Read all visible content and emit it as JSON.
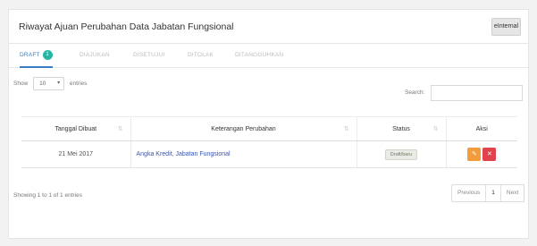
{
  "panel": {
    "title": "Riwayat Ajuan Perubahan Data Jabatan Fungsional",
    "internal_button": "eInternal"
  },
  "tabs": [
    {
      "label": "DRAFT",
      "count": "1",
      "active": true
    },
    {
      "label": "DIAJUKAN",
      "active": false
    },
    {
      "label": "DISETUJUI",
      "active": false
    },
    {
      "label": "DITOLAK",
      "active": false
    },
    {
      "label": "DITANGGUHKAN",
      "active": false
    }
  ],
  "length_control": {
    "show": "Show",
    "value": "10",
    "entries": "entries"
  },
  "search": {
    "label": "Search:",
    "placeholder": ""
  },
  "table": {
    "headers": [
      "Tanggal Dibuat",
      "Keterangan Perubahan",
      "Status",
      "Aksi"
    ],
    "rows": [
      {
        "date": "21 Mei 2017",
        "description": "Angka Kredit, Jabatan Fungsional",
        "status": "Draft/baru"
      }
    ]
  },
  "actions": {
    "edit_icon": "pencil-icon",
    "delete_icon": "times-icon",
    "edit_color": "#f39c3c",
    "delete_color": "#e0434b"
  },
  "footer": {
    "info": "Showing 1 to 1 of 1 entries",
    "previous": "Previous",
    "page": "1",
    "next": "Next"
  }
}
